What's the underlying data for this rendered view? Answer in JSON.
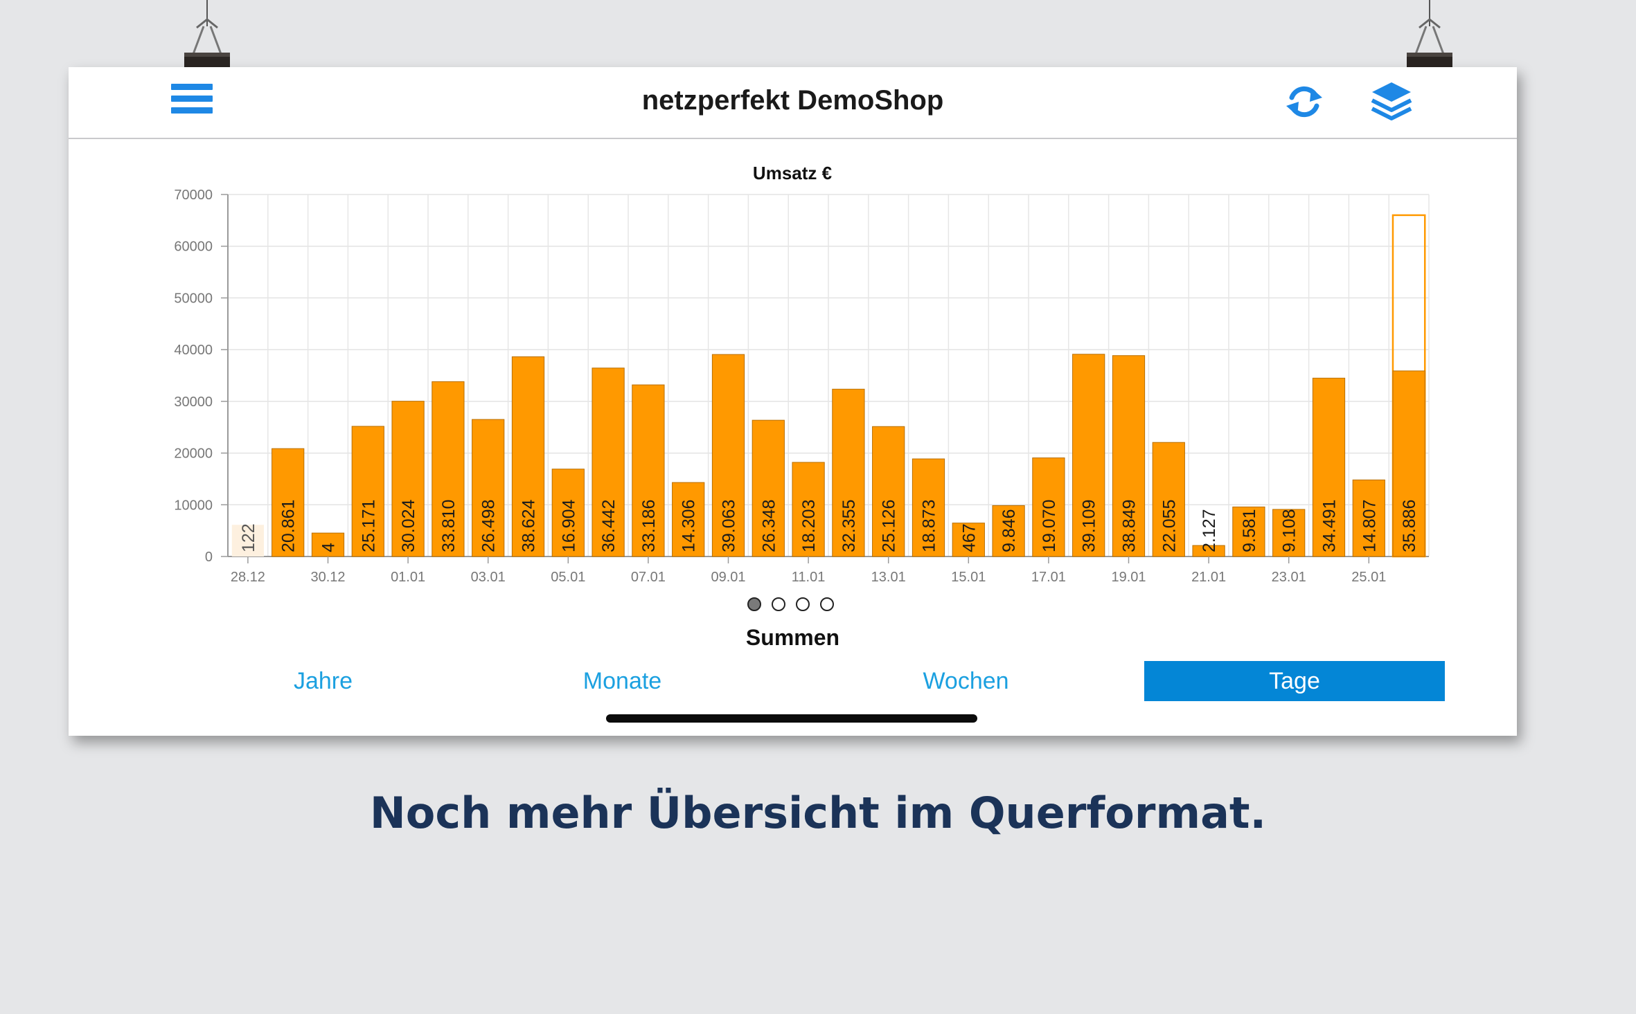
{
  "app": {
    "title": "netzperfekt DemoShop"
  },
  "toolbar": {
    "menu_icon": "hamburger-menu-icon",
    "refresh_icon": "refresh-icon",
    "layers_icon": "layers-icon",
    "accent_color": "#1e88e5"
  },
  "chart_data": {
    "type": "bar",
    "title": "Umsatz €",
    "ylim": [
      0,
      70000
    ],
    "yticks": [
      "0",
      "10000",
      "20000",
      "30000",
      "40000",
      "50000",
      "60000",
      "70000"
    ],
    "xtick_labels": [
      "28.12",
      "30.12",
      "01.01",
      "03.01",
      "05.01",
      "07.01",
      "09.01",
      "11.01",
      "13.01",
      "15.01",
      "17.01",
      "19.01",
      "21.01",
      "23.01",
      "25.01"
    ],
    "bar_color": "#ff9900",
    "grid": true,
    "legend": "none",
    "values": [
      6122,
      20861,
      4534,
      25171,
      30024,
      33810,
      26498,
      38624,
      16904,
      36442,
      33186,
      14306,
      39063,
      26348,
      18203,
      32355,
      25126,
      18873,
      6467,
      9846,
      19070,
      39109,
      38849,
      22055,
      2127,
      9581,
      9108,
      34491,
      14807,
      35886
    ],
    "value_labels": [
      "122",
      "20.861",
      "4",
      "25.171",
      "30.024",
      "33.810",
      "26.498",
      "38.624",
      "16.904",
      "36.442",
      "33.186",
      "14.306",
      "39.063",
      "26.348",
      "18.203",
      "32.355",
      "25.126",
      "18.873",
      "467",
      "9.846",
      "19.070",
      "39.109",
      "38.849",
      "22.055",
      "2.127",
      "9.581",
      "9.108",
      "34.491",
      "14.807",
      "35.886"
    ],
    "first_bar_faded": true,
    "last_bar_outline_value": 66000
  },
  "pager": {
    "count": 4,
    "active": 0
  },
  "section": {
    "title": "Summen"
  },
  "tabs": [
    {
      "label": "Jahre",
      "active": false
    },
    {
      "label": "Monate",
      "active": false
    },
    {
      "label": "Wochen",
      "active": false
    },
    {
      "label": "Tage",
      "active": true
    }
  ],
  "caption": "Noch mehr Übersicht im Querformat."
}
